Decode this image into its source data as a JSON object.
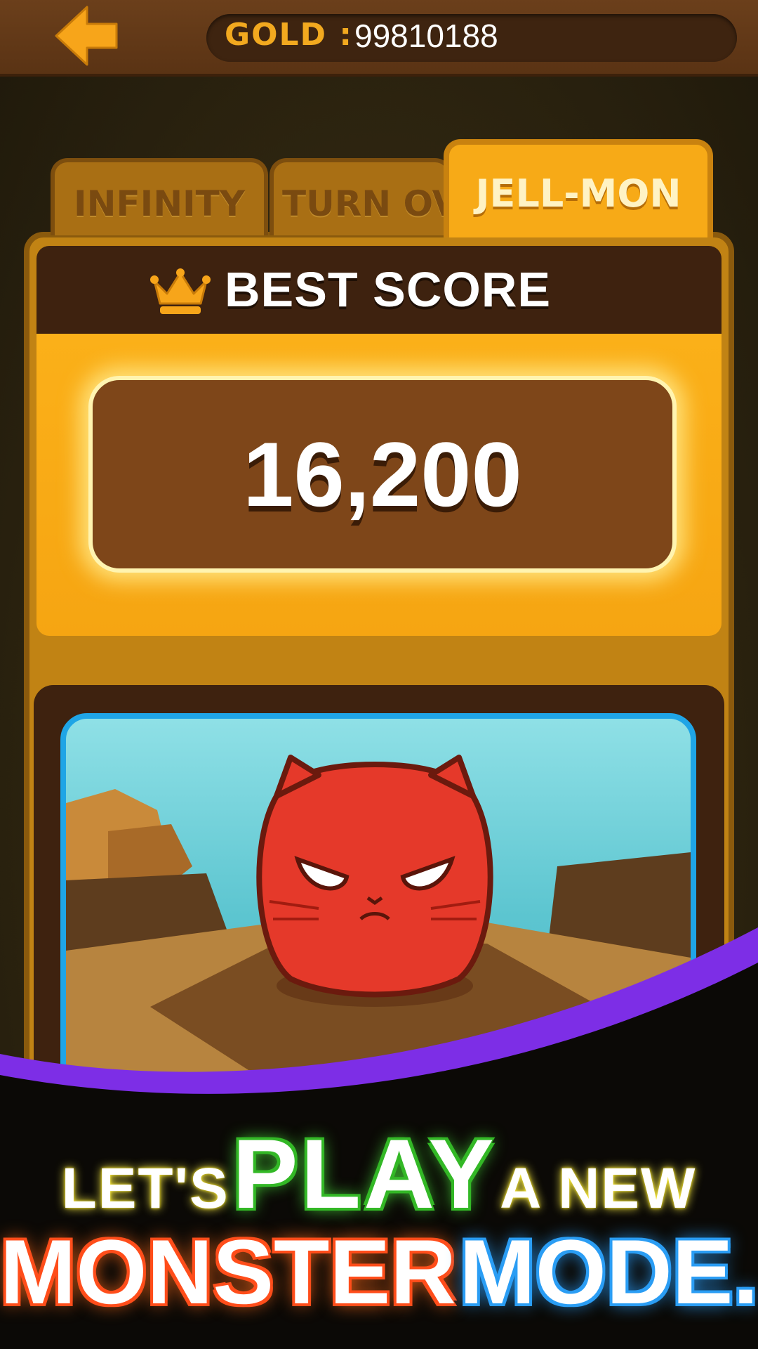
{
  "topbar": {
    "back_icon": "back-arrow-icon",
    "gold_label": "GOLD :",
    "gold_value": "99810188"
  },
  "tabs": [
    {
      "label": "INFINITY",
      "active": false
    },
    {
      "label": "TURN OVI",
      "active": false
    },
    {
      "label": "JELL-MON",
      "active": true
    }
  ],
  "best_score": {
    "icon": "crown-icon",
    "label": "BEST SCORE",
    "value": "16,200"
  },
  "preview": {
    "image": "red-cat-jelly-monster"
  },
  "promo": {
    "line1": [
      "LET'S",
      "PLAY",
      "A NEW"
    ],
    "line2": [
      "MONSTER",
      "MODE."
    ]
  },
  "colors": {
    "accent_orange": "#f7aa17",
    "gold_text": "#f2a91f",
    "frame_blue": "#1fa5e6",
    "promo_purple": "#7d2ee6"
  }
}
